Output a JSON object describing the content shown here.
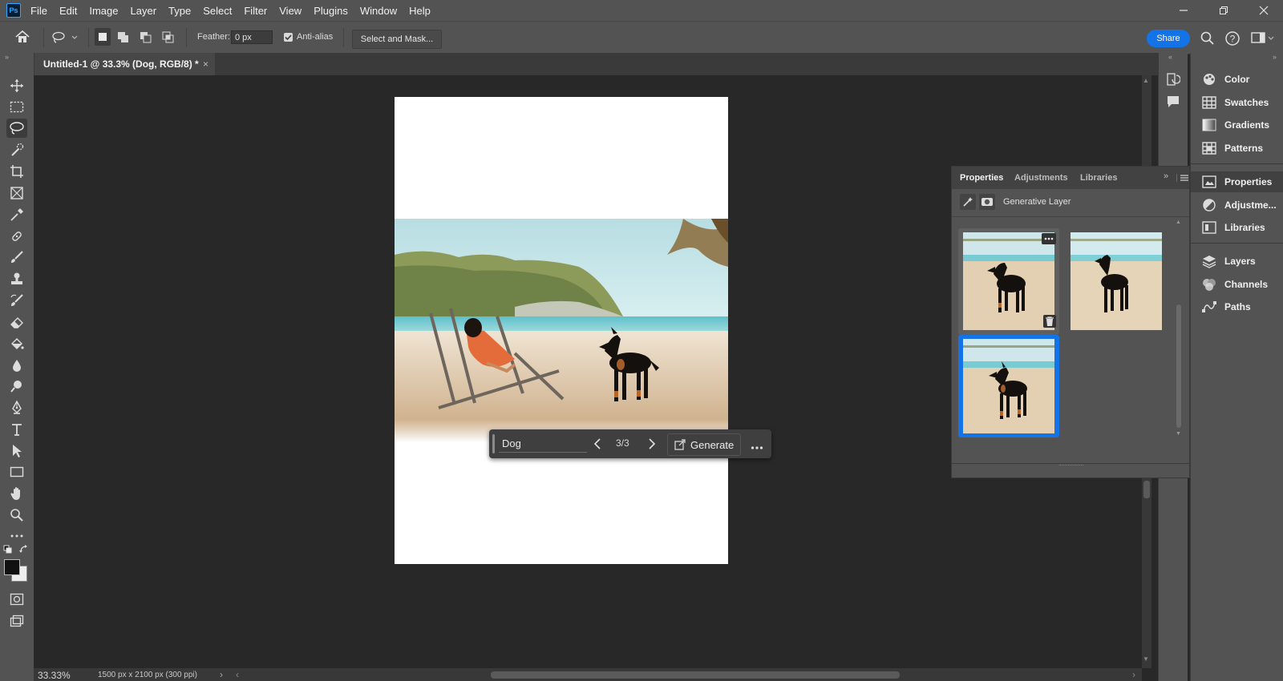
{
  "app": {
    "logo": "Ps"
  },
  "menu": [
    "File",
    "Edit",
    "Image",
    "Layer",
    "Type",
    "Select",
    "Filter",
    "View",
    "Plugins",
    "Window",
    "Help"
  ],
  "options_bar": {
    "feather_label": "Feather:",
    "feather_value": "0 px",
    "anti_alias_label": "Anti-alias",
    "anti_alias_checked": true,
    "select_and_mask": "Select and Mask...",
    "share": "Share",
    "accent_color": "#1473e6"
  },
  "document_tab": {
    "title": "Untitled-1 @ 33.3% (Dog, RGB/8) *",
    "close": "×"
  },
  "tools": [
    "move-tool",
    "marquee-tool",
    "lasso-tool",
    "quick-select-tool",
    "crop-tool",
    "frame-tool",
    "eyedropper-tool",
    "healing-tool",
    "brush-tool",
    "stamp-tool",
    "history-brush-tool",
    "eraser-tool",
    "paint-bucket-tool",
    "blur-tool",
    "dodge-tool",
    "pen-tool",
    "type-tool",
    "path-select-tool",
    "rectangle-tool",
    "hand-tool",
    "zoom-tool",
    "more-tools"
  ],
  "active_tool": "lasso-tool",
  "contextual_bar": {
    "prompt": "Dog",
    "counter": "3/3",
    "generate": "Generate"
  },
  "status_bar": {
    "zoom": "33.33%",
    "doc_info": "1500 px x 2100 px (300 ppi)"
  },
  "properties_panel": {
    "tabs": [
      "Properties",
      "Adjustments",
      "Libraries"
    ],
    "active_tab": "Properties",
    "layer_type": "Generative Layer",
    "variations_count": 3,
    "selected_variation": 3
  },
  "right_panel": {
    "group1": [
      "Color",
      "Swatches",
      "Gradients",
      "Patterns"
    ],
    "group2": [
      "Properties",
      "Adjustme..."
    ],
    "group2b": [
      "Libraries"
    ],
    "group3": [
      "Layers",
      "Channels",
      "Paths"
    ]
  }
}
